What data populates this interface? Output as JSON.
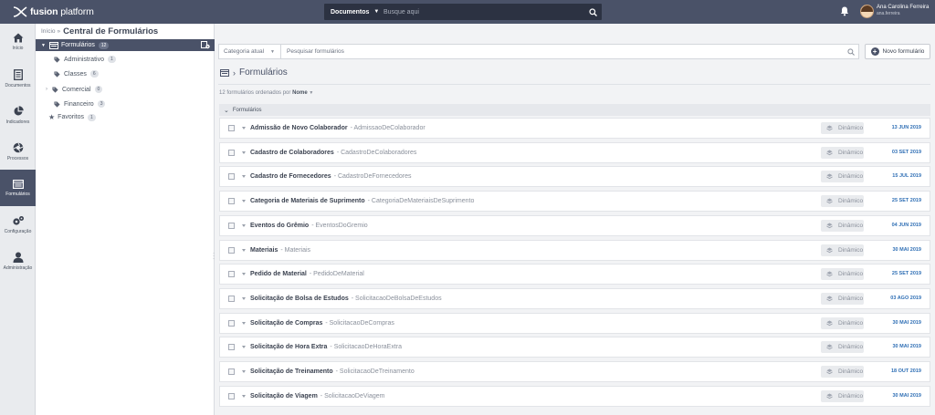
{
  "brand": {
    "name_bold": "fusion",
    "name_rest": "platform"
  },
  "search": {
    "scope": "Documentos",
    "placeholder": "Busque aqui"
  },
  "user": {
    "name": "Ana Carolina Ferreira",
    "login": "ana.ferreira"
  },
  "leftnav": [
    {
      "label": "Início",
      "icon": "home-icon"
    },
    {
      "label": "Documentos",
      "icon": "document-icon"
    },
    {
      "label": "Indicadores",
      "icon": "pie-chart-icon"
    },
    {
      "label": "Processos",
      "icon": "aperture-icon"
    },
    {
      "label": "Formulários",
      "icon": "form-icon",
      "active": true
    },
    {
      "label": "Configuração",
      "icon": "gears-icon"
    },
    {
      "label": "Administração",
      "icon": "user-icon"
    }
  ],
  "breadcrumb": {
    "root": "Início",
    "sep": "»",
    "current": "Central de Formulários"
  },
  "tree": {
    "root": {
      "label": "Formulários",
      "count": "12"
    },
    "children": [
      {
        "label": "Administrativo",
        "count": "1"
      },
      {
        "label": "Classes",
        "count": "6"
      },
      {
        "label": "Comercial",
        "count": "0"
      },
      {
        "label": "Financeiro",
        "count": "3"
      }
    ],
    "favorites": {
      "label": "Favoritos",
      "count": "1"
    }
  },
  "filter": {
    "category": "Categoria atual",
    "placeholder": "Pesquisar formulários"
  },
  "new_button": "Novo formulário",
  "section_title": "Formulários",
  "sort_info": {
    "text": "12 formulários ordenados por",
    "field": "Nome"
  },
  "group": {
    "label": "Formulários"
  },
  "rows": [
    {
      "title": "Admissão de Novo Colaborador",
      "code": "- AdmissaoDeColaborador",
      "type": "Dinâmico",
      "date": "13 JUN 2019"
    },
    {
      "title": "Cadastro de Colaboradores",
      "code": "- CadastroDeColaboradores",
      "type": "Dinâmico",
      "date": "03 SET 2019"
    },
    {
      "title": "Cadastro de Fornecedores",
      "code": "- CadastroDeFornecedores",
      "type": "Dinâmico",
      "date": "15 JUL 2019"
    },
    {
      "title": "Categoria de Materiais de Suprimento",
      "code": "- CategoriaDeMateriaisDeSuprimento",
      "type": "Dinâmico",
      "date": "25 SET 2019"
    },
    {
      "title": "Eventos do Grêmio",
      "code": "- EventosDoGremio",
      "type": "Dinâmico",
      "date": "04 JUN 2019"
    },
    {
      "title": "Materiais",
      "code": "- Materiais",
      "type": "Dinâmico",
      "date": "30 MAI 2019"
    },
    {
      "title": "Pedido de Material",
      "code": "- PedidoDeMaterial",
      "type": "Dinâmico",
      "date": "25 SET 2019"
    },
    {
      "title": "Solicitação de Bolsa de Estudos",
      "code": "- SolicitacaoDeBolsaDeEstudos",
      "type": "Dinâmico",
      "date": "03 AGO 2019"
    },
    {
      "title": "Solicitação de Compras",
      "code": "- SolicitacaoDeCompras",
      "type": "Dinâmico",
      "date": "30 MAI 2019"
    },
    {
      "title": "Solicitação de Hora Extra",
      "code": "- SolicitacaoDeHoraExtra",
      "type": "Dinâmico",
      "date": "30 MAI 2019"
    },
    {
      "title": "Solicitação de Treinamento",
      "code": "- SolicitacaoDeTreinamento",
      "type": "Dinâmico",
      "date": "18 OUT 2019"
    },
    {
      "title": "Solicitação de Viagem",
      "code": "- SolicitacaoDeViagem",
      "type": "Dinâmico",
      "date": "30 MAI 2019"
    }
  ],
  "colors": {
    "topbar": "#4a5268",
    "accent_date": "#2f6fb5",
    "active_nav": "#4a5268"
  }
}
